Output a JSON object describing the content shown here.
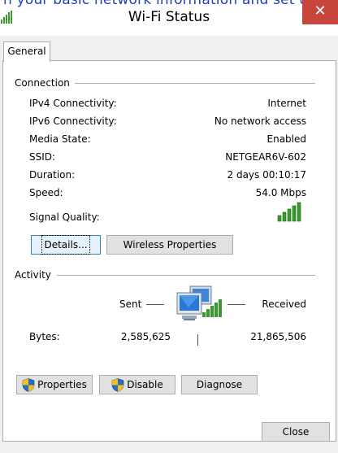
{
  "background_text": "n your basic network information and set up co",
  "window": {
    "title": "Wi-Fi Status",
    "close_glyph": "✕"
  },
  "tab": {
    "label": "General"
  },
  "connection": {
    "section_label": "Connection",
    "rows": [
      {
        "label": "IPv4 Connectivity:",
        "value": "Internet"
      },
      {
        "label": "IPv6 Connectivity:",
        "value": "No network access"
      },
      {
        "label": "Media State:",
        "value": "Enabled"
      },
      {
        "label": "SSID:",
        "value": "NETGEAR6V-602"
      },
      {
        "label": "Duration:",
        "value": "2 days 00:10:17"
      },
      {
        "label": "Speed:",
        "value": "54.0 Mbps"
      }
    ],
    "signal_label": "Signal Quality:",
    "signal_bars": 5,
    "details_button": "Details...",
    "wireless_button": "Wireless Properties"
  },
  "activity": {
    "section_label": "Activity",
    "sent_label": "Sent",
    "received_label": "Received",
    "bytes_label": "Bytes:",
    "bytes_sent": "2,585,625",
    "bytes_received": "21,865,506"
  },
  "buttons": {
    "properties": "Properties",
    "disable": "Disable",
    "diagnose": "Diagnose",
    "close": "Close"
  },
  "colors": {
    "signal_green": "#3a9a2e",
    "titlebar_close": "#c7453d",
    "shield_blue": "#2a6ac8",
    "shield_yellow": "#f2c21b"
  }
}
